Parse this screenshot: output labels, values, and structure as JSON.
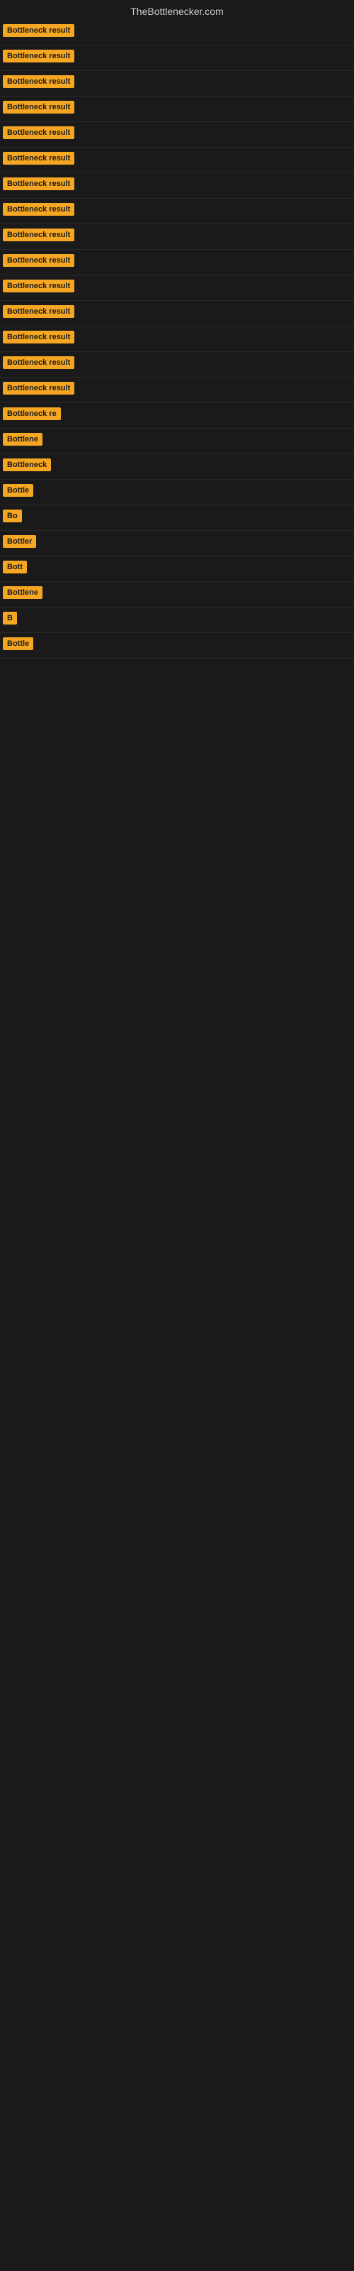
{
  "header": {
    "title": "TheBottlenecker.com"
  },
  "rows": [
    {
      "label": "Bottleneck result",
      "truncated": "Bottleneck result"
    },
    {
      "label": "Bottleneck result",
      "truncated": "Bottleneck result"
    },
    {
      "label": "Bottleneck result",
      "truncated": "Bottleneck result"
    },
    {
      "label": "Bottleneck result",
      "truncated": "Bottleneck result"
    },
    {
      "label": "Bottleneck result",
      "truncated": "Bottleneck result"
    },
    {
      "label": "Bottleneck result",
      "truncated": "Bottleneck result"
    },
    {
      "label": "Bottleneck result",
      "truncated": "Bottleneck result"
    },
    {
      "label": "Bottleneck result",
      "truncated": "Bottleneck result"
    },
    {
      "label": "Bottleneck result",
      "truncated": "Bottleneck result"
    },
    {
      "label": "Bottleneck result",
      "truncated": "Bottleneck result"
    },
    {
      "label": "Bottleneck result",
      "truncated": "Bottleneck result"
    },
    {
      "label": "Bottleneck result",
      "truncated": "Bottleneck result"
    },
    {
      "label": "Bottleneck result",
      "truncated": "Bottleneck result"
    },
    {
      "label": "Bottleneck result",
      "truncated": "Bottleneck result"
    },
    {
      "label": "Bottleneck result",
      "truncated": "Bottleneck result"
    },
    {
      "label": "Bottleneck re",
      "truncated": "Bottleneck re"
    },
    {
      "label": "Bottlene",
      "truncated": "Bottlene"
    },
    {
      "label": "Bottleneck",
      "truncated": "Bottleneck"
    },
    {
      "label": "Bottle",
      "truncated": "Bottle"
    },
    {
      "label": "Bo",
      "truncated": "Bo"
    },
    {
      "label": "Bottler",
      "truncated": "Bottler"
    },
    {
      "label": "Bott",
      "truncated": "Bott"
    },
    {
      "label": "Bottlene",
      "truncated": "Bottlene"
    },
    {
      "label": "B",
      "truncated": "B"
    },
    {
      "label": "Bottle",
      "truncated": "Bottle"
    }
  ]
}
